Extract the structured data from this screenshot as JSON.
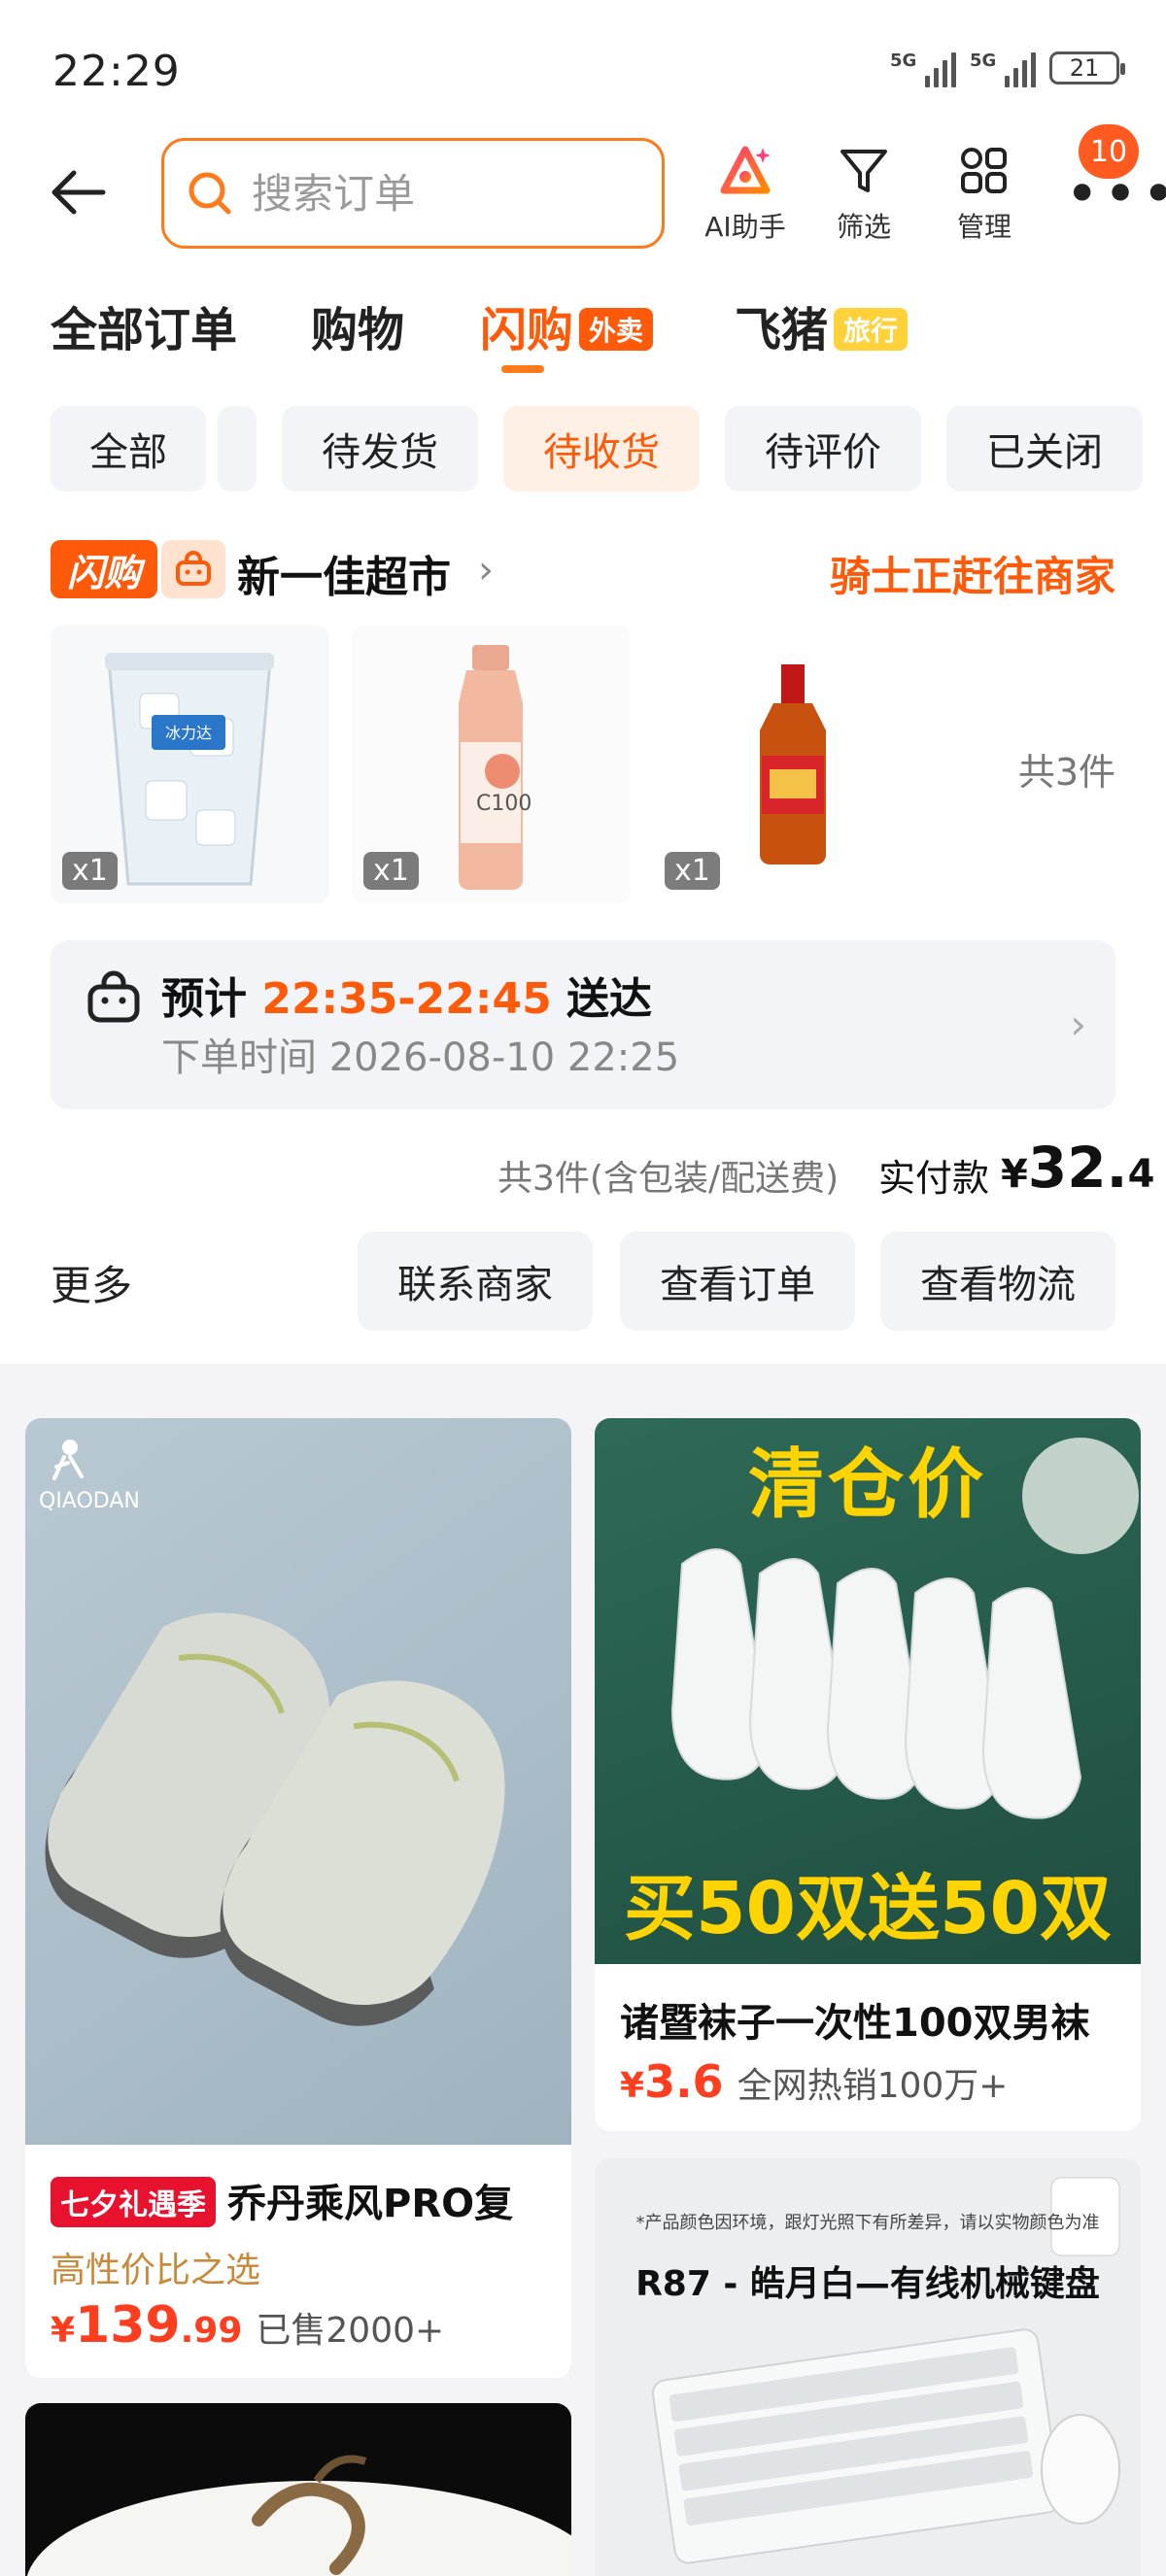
{
  "status_bar": {
    "time": "22:29",
    "signal1": "5G",
    "signal2": "5G",
    "battery": "21"
  },
  "header": {
    "search_placeholder": "搜索订单",
    "ai_label": "AI助手",
    "filter_label": "筛选",
    "manage_label": "管理",
    "more_badge": "10"
  },
  "tabs": {
    "all": "全部订单",
    "shopping": "购物",
    "flash": "闪购",
    "flash_tag": "外卖",
    "fliggy": "飞猪",
    "fliggy_tag": "旅行"
  },
  "filters": {
    "all": "全部",
    "to_ship": "待发货",
    "to_receive": "待收货",
    "to_review": "待评价",
    "closed": "已关闭"
  },
  "order": {
    "flash_badge": "闪购",
    "store_name": "新一佳超市",
    "status": "骑士正赶往商家",
    "items": [
      {
        "name": "冰力达",
        "qty": "x1"
      },
      {
        "name": "水溶C100",
        "qty": "x1"
      },
      {
        "name": "酒",
        "qty": "x1"
      }
    ],
    "item_count": "共3件",
    "delivery_prefix": "预计",
    "delivery_time": "22:35-22:45",
    "delivery_suffix": "送达",
    "order_time": "下单时间 2026-08-10 22:25",
    "pay_desc": "共3件(含包装/配送费)",
    "pay_label": "实付款",
    "pay_symbol": "¥",
    "pay_int": "32.",
    "pay_dec": "4",
    "more": "更多",
    "btn_contact": "联系商家",
    "btn_view_order": "查看订单",
    "btn_logistics": "查看物流"
  },
  "recommendations": {
    "shoe": {
      "brand": "QIAODAN",
      "promo_tag": "七夕礼遇季",
      "title": "乔丹乘风PRO复",
      "subtitle": "高性价比之选",
      "price_symbol": "¥",
      "price_int": "139",
      "price_dec": ".99",
      "sold": "已售2000+"
    },
    "socks": {
      "banner_top": "清仓价",
      "banner_bottom": "买50双送50双",
      "title": "诸暨袜子一次性100双男袜",
      "price_symbol": "¥",
      "price_int": "3.6",
      "sold": "全网热销100万+"
    },
    "keyboard": {
      "note": "*产品颜色因环境，跟灯光照下有所差异，请以实物颜色为准",
      "title": "R87 - 皓月白—有线机械键盘"
    }
  },
  "colors": {
    "accent": "#ff5a0a",
    "price": "#ff3d1f",
    "promo": "#e8122e"
  }
}
